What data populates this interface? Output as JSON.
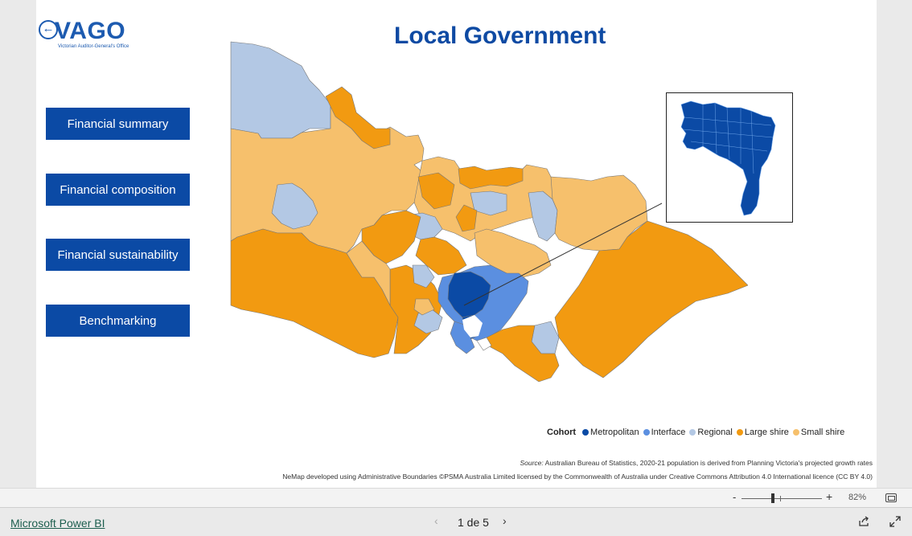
{
  "logo": {
    "word": "VAGO",
    "sub": "Victorian Auditor-General's Office"
  },
  "title": "Local Government",
  "nav": [
    {
      "label": "Financial summary"
    },
    {
      "label": "Financial composition"
    },
    {
      "label": "Financial sustainability"
    },
    {
      "label": "Benchmarking"
    }
  ],
  "colors": {
    "metropolitan": "#0b4aa5",
    "interface": "#5b8fe0",
    "regional": "#b3c8e4",
    "large_shire": "#f29a11",
    "small_shire": "#f6c06c",
    "nav_bg": "#0b4aa5",
    "title": "#0e4aa3"
  },
  "legend": {
    "title": "Cohort",
    "items": [
      {
        "label": "Metropolitan",
        "color": "#0b4aa5"
      },
      {
        "label": "Interface",
        "color": "#5b8fe0"
      },
      {
        "label": "Regional",
        "color": "#b3c8e4"
      },
      {
        "label": "Large shire",
        "color": "#f29a11"
      },
      {
        "label": "Small shire",
        "color": "#f6c06c"
      }
    ]
  },
  "source": {
    "label": "Source:",
    "text": " Australian Bureau of Statistics, 2020-21 population is derived from Planning Victoria's projected growth rates"
  },
  "nemap_note": "NeMap developed using Administrative Boundaries ©PSMA Australia Limited licensed by the Commonwealth of Australia under Creative Commons Attribution 4.0 International licence (CC BY 4.0)",
  "zoom": {
    "minus": "-",
    "plus": "+",
    "level": "82%",
    "value_percent": 82
  },
  "footer": {
    "app_link": "Microsoft Power BI",
    "page": "1 de 5",
    "prev": "‹",
    "next": "›"
  }
}
